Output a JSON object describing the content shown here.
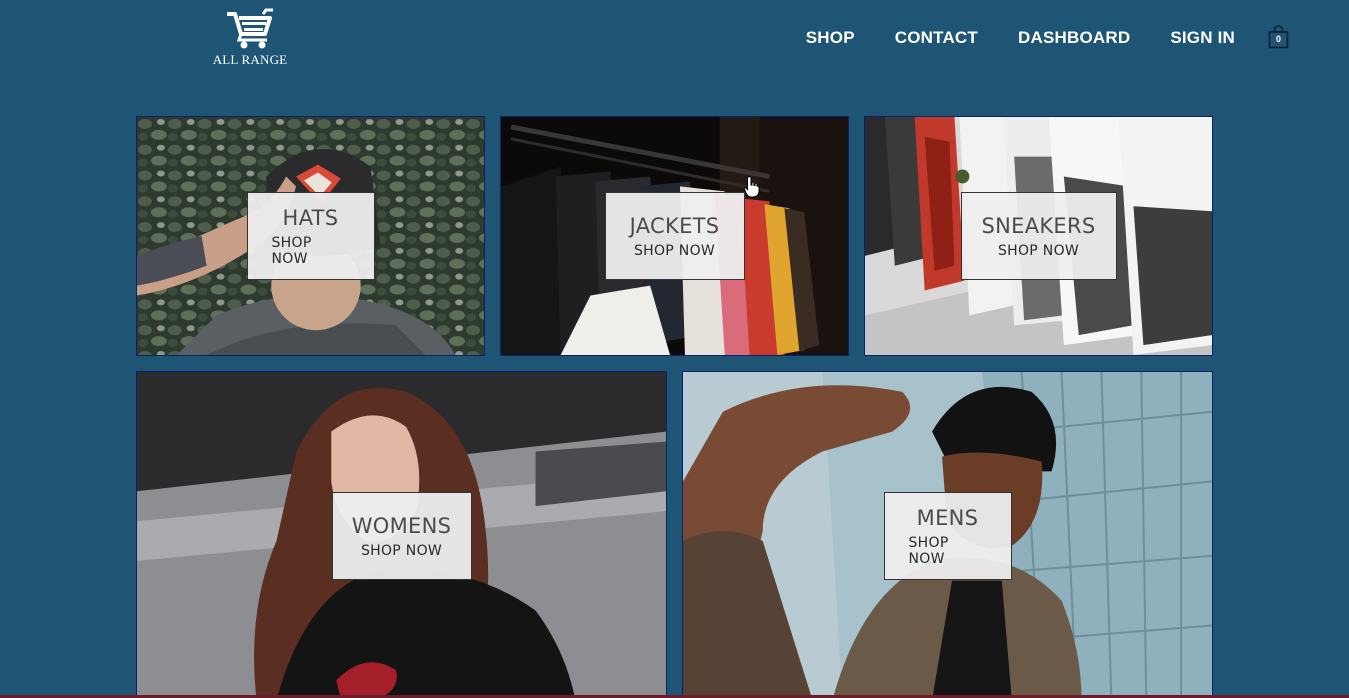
{
  "header": {
    "logo": {
      "icon": "shopping-cart-icon",
      "text": "ALL RANGE"
    },
    "nav": {
      "shop": "SHOP",
      "contact": "CONTACT",
      "dashboard": "DASHBOARD",
      "sign_in": "SIGN IN"
    },
    "cart": {
      "icon": "shopping-bag-icon",
      "count": "0"
    }
  },
  "directory": {
    "hats": {
      "title": "HATS",
      "cta": "SHOP NOW"
    },
    "jackets": {
      "title": "JACKETS",
      "cta": "SHOP NOW"
    },
    "sneakers": {
      "title": "SNEAKERS",
      "cta": "SHOP NOW"
    },
    "womens": {
      "title": "WOMENS",
      "cta": "SHOP NOW"
    },
    "mens": {
      "title": "MENS",
      "cta": "SHOP NOW"
    }
  },
  "colors": {
    "background": "#1f5574",
    "tile_border": "#0d1f6e",
    "label_box": "#eeeeee",
    "nav_text": "#ffffff"
  }
}
